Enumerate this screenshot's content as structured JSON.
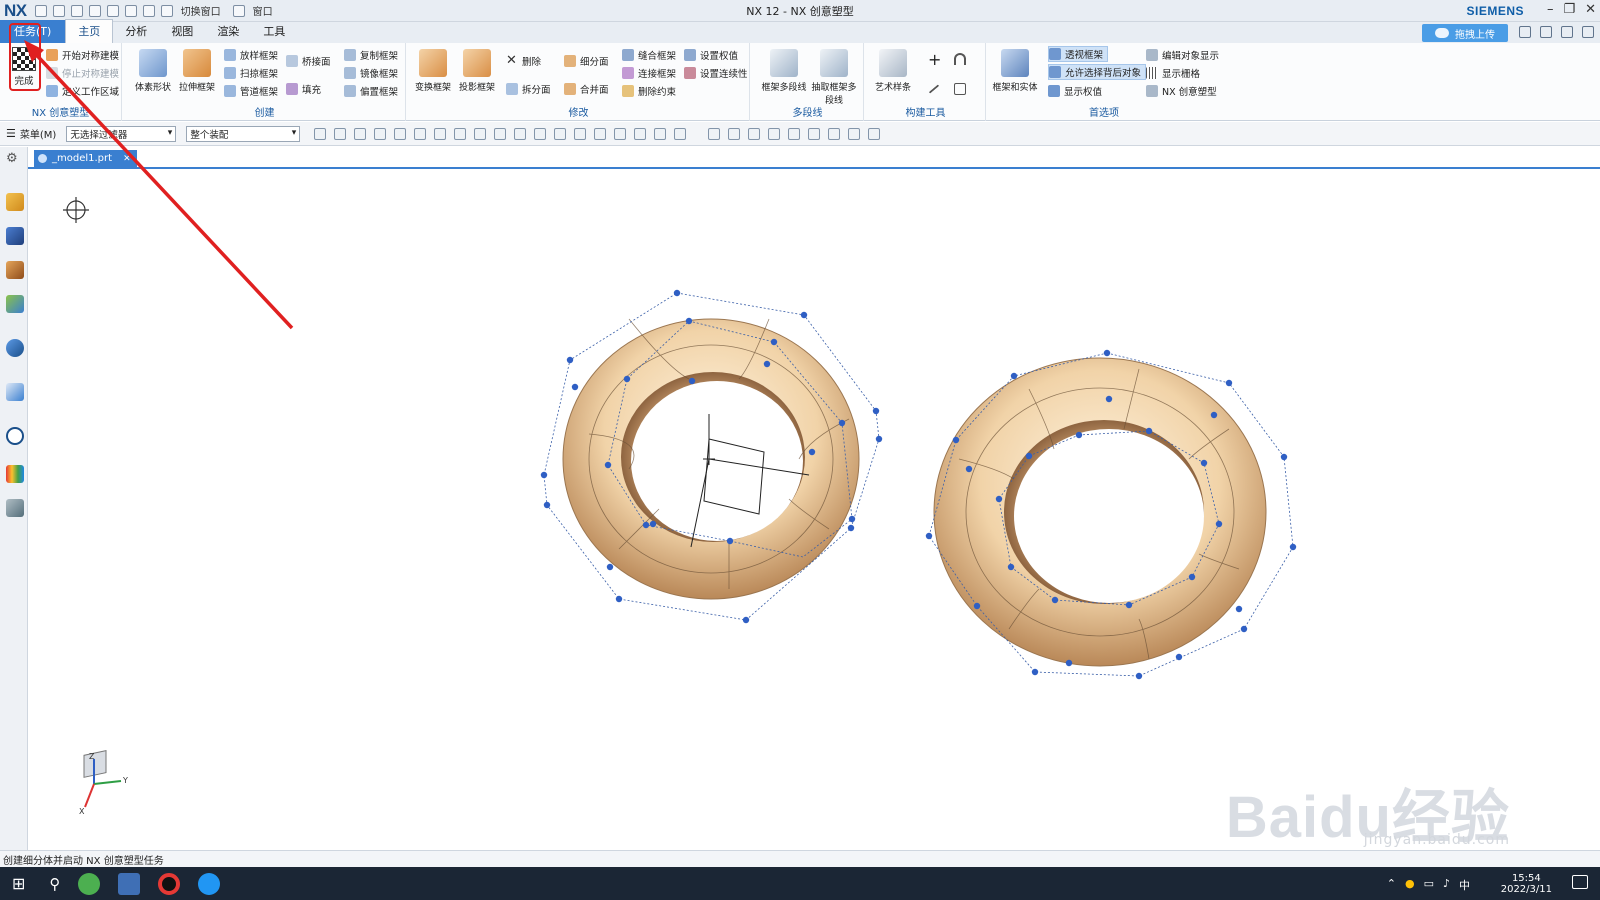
{
  "titlebar": {
    "logo": "NX",
    "title": "NX 12 - NX 创意塑型",
    "brand": "SIEMENS",
    "switch_window": "切换窗口",
    "window": "窗口"
  },
  "tabs": {
    "task": "任务(T)",
    "items": [
      "主页",
      "分析",
      "视图",
      "渲染",
      "工具"
    ],
    "upload": "拖拽上传"
  },
  "ribbon": {
    "finish": "完成",
    "nx_group": {
      "label": "NX 创意塑型",
      "items": [
        "开始对称建模",
        "停止对称建模",
        "定义工作区域"
      ]
    },
    "create_group": {
      "label": "创建",
      "big": [
        "体素形状",
        "拉伸框架"
      ],
      "small": [
        "放样框架",
        "扫掠框架",
        "管道框架",
        "桥接面",
        "填充",
        "复制框架",
        "镜像框架",
        "偏置框架"
      ]
    },
    "modify_group": {
      "label": "修改",
      "big": [
        "变换框架",
        "投影框架"
      ],
      "small": [
        "删除",
        "拆分面",
        "细分面",
        "合并面",
        "缝合框架",
        "连接框架",
        "删除约束",
        "设置权值",
        "设置连续性"
      ]
    },
    "polyline_group": {
      "label": "多段线",
      "big": [
        "框架多段线",
        "抽取框架多段线"
      ]
    },
    "construct_group": {
      "label": "构建工具",
      "big": [
        "艺术样条"
      ]
    },
    "prefs_group": {
      "label": "首选项",
      "big": [
        "框架和实体"
      ],
      "small": [
        "透视框架",
        "允许选择背后对象",
        "显示权值",
        "编辑对象显示",
        "显示栅格",
        "NX 创意塑型"
      ]
    }
  },
  "selection_bar": {
    "menu": "菜单(M)",
    "filter": "无选择过滤器",
    "scope": "整个装配"
  },
  "document": {
    "tab_label": "_model1.prt"
  },
  "status": {
    "message": "创建细分体并启动 NX 创意塑型任务"
  },
  "taskbar": {
    "time": "15:54",
    "date": "2022/3/11",
    "ime": "中"
  },
  "watermark": {
    "main": "Baidu经验",
    "sub": "jingyan.baidu.com"
  },
  "colors": {
    "accent": "#3a7fd0",
    "annotation_arrow": "#e02020",
    "torus_fill": "#f3d9b5",
    "cage_points": "#2f5fc4"
  }
}
